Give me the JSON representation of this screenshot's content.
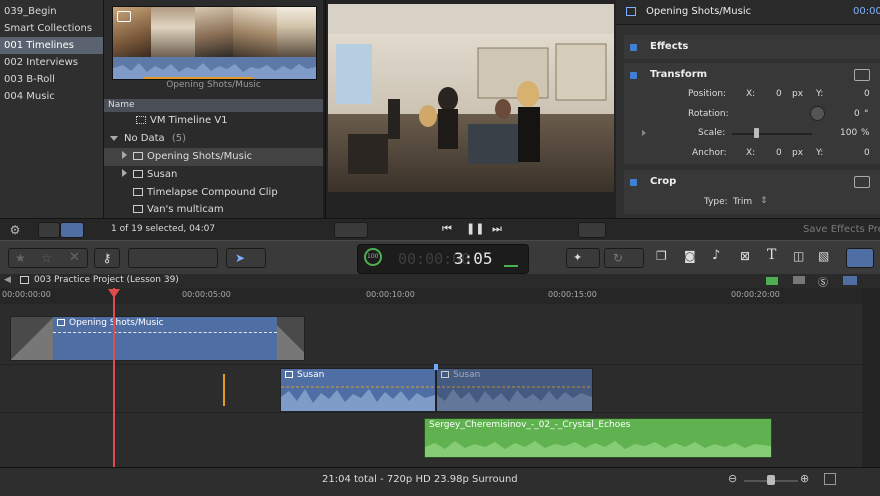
{
  "library": {
    "items": [
      {
        "label": "039_Begin",
        "selected": false
      },
      {
        "label": "Smart Collections",
        "selected": false
      },
      {
        "label": "001 Timelines",
        "selected": true
      },
      {
        "label": "002 Interviews",
        "selected": false
      },
      {
        "label": "003 B-Roll",
        "selected": false
      },
      {
        "label": "004 Music",
        "selected": false
      }
    ]
  },
  "browser": {
    "filmstrip_label": "Opening Shots/Music",
    "list_header": "Name",
    "rows": [
      {
        "label": "VM Timeline V1"
      },
      {
        "label": "No Data",
        "count": "(5)"
      },
      {
        "label": "Opening Shots/Music"
      },
      {
        "label": "Susan"
      },
      {
        "label": "Timelapse Compound Clip"
      },
      {
        "label": "Van's multicam"
      }
    ],
    "selection_status": "1 of 19 selected, 04:07"
  },
  "inspector": {
    "title": "Opening Shots/Music",
    "timecode": "00:00",
    "effects_label": "Effects",
    "transform_label": "Transform",
    "position": {
      "label": "Position:",
      "x_label": "X:",
      "x": "0",
      "x_unit": "px",
      "y_label": "Y:",
      "y": "0"
    },
    "rotation": {
      "label": "Rotation:",
      "value": "0",
      "unit": "°"
    },
    "scale": {
      "label": "Scale:",
      "value": "100",
      "unit": "%"
    },
    "anchor": {
      "label": "Anchor:",
      "x_label": "X:",
      "x": "0",
      "x_unit": "px",
      "y_label": "Y:",
      "y": "0"
    },
    "crop_label": "Crop",
    "type_label": "Type:",
    "type_value": "Trim",
    "save_button": "Save Effects Pre"
  },
  "dashboard": {
    "percent": "100",
    "timecode_dim": "00:00:00",
    "timecode": "3:05"
  },
  "timeline": {
    "project_name": "003 Practice Project (Lesson 39)",
    "ruler_ticks": [
      "00:00:00:00",
      "00:00:05:00",
      "00:00:10:00",
      "00:00:15:00",
      "00:00:20:00"
    ],
    "clips": {
      "compound": "Opening Shots/Music",
      "susan_1": "Susan",
      "susan_2": "Susan",
      "music": "Sergey_Cheremisinov_-_02_-_Crystal_Echoes"
    },
    "status": "21:04 total - 720p HD 23.98p Surround"
  },
  "colors": {
    "accent_blue": "#3f7fd6",
    "clip_blue": "#4f6ea3",
    "audio_green": "#5fb24f",
    "playhead": "#e04c4c"
  }
}
